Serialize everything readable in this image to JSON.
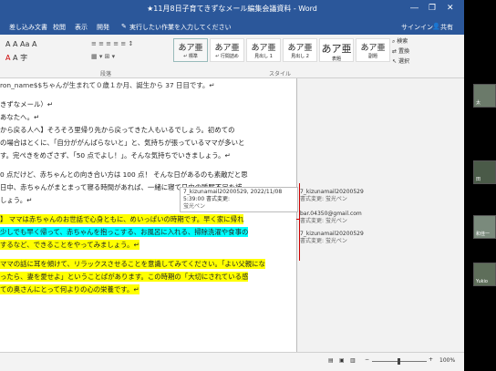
{
  "window": {
    "title": "★11月8日子育てきずなメール編集会議資料 - Word",
    "minimize": "―",
    "restore": "❐",
    "close": "✕"
  },
  "tabs": [
    "差し込み文書",
    "校閲",
    "表示",
    "開発"
  ],
  "tell_me": "実行したい作業を入力してください",
  "account": {
    "signin": "サインイン",
    "share": "共有"
  },
  "ribbon": {
    "styles": [
      {
        "sample": "あア亜",
        "label": "↵ 標準"
      },
      {
        "sample": "あア亜",
        "label": "↵ 行間詰め"
      },
      {
        "sample": "あア亜",
        "label": "見出し 1"
      },
      {
        "sample": "あア亜",
        "label": "見出し 2"
      },
      {
        "sample": "あア亜",
        "label": "表題"
      },
      {
        "sample": "あア亜",
        "label": "副題"
      }
    ],
    "groups": {
      "paragraph": "段落",
      "styles": "スタイル"
    },
    "editing": {
      "find": "検索",
      "replace": "置換",
      "select": "選択"
    },
    "font_tools": "A  A  Aa  A"
  },
  "document": {
    "lines": [
      {
        "text": "ron_name$$ちゃんが生まれて０歳１か月、誕生から 37 日目です。↵",
        "style": "none"
      },
      {
        "text": "きずなメール）↵",
        "style": "none"
      },
      {
        "text": "あなたへ。↵",
        "style": "none"
      },
      {
        "text": "から戻る人へ】そろそろ里帰り先から戻ってきた人もいるでしょう。初めての",
        "style": "none"
      },
      {
        "text": "の場合はとくに、「自分ががんばらないと」と、気持ちが張っているママが多いと",
        "style": "none"
      },
      {
        "text": "す。完ぺきをめざさず、「50 点でよし！」。そんな気持ちでいきましょう。↵",
        "style": "none"
      },
      {
        "text": "0 点だけど、赤ちゃんとの向き合い方は 100 点！ そんな日があるのも素敵だと思",
        "style": "none"
      },
      {
        "text": "日中、赤ちゃんがまとまって寝る時間があれば、一緒に寝て日中の睡眠不足を補",
        "style": "none"
      },
      {
        "text": "しょう。↵",
        "style": "none"
      },
      {
        "text": "】 ママは赤ちゃんのお世話で心身ともに、めいっぱいの時期です。早く家に帰れ",
        "style": "yellow"
      },
      {
        "text": "少しでも早く帰って、赤ちゃんを抱っこする、お風呂に入れる、掃除洗濯や食事の",
        "style": "cyan"
      },
      {
        "text": "するなど、できることをやってみましょう。↵",
        "style": "yellow"
      },
      {
        "text": "ママの話に耳を傾けて、リラックスさせることを意識してみてください。「よい父親にな",
        "style": "yellow"
      },
      {
        "text": "ったら、妻を愛せよ」ということばがあります。この時期の「大切にされている感",
        "style": "yellow"
      },
      {
        "text": "ての奥さんにとって何よりの心の栄養です。↵",
        "style": "yellow"
      }
    ]
  },
  "comments": [
    {
      "author": "7_kizunamail20200529, 2022/11/08",
      "meta": "5:39:00 書式変更:",
      "extra": "蛍光ペン"
    },
    {
      "author": "7_kizunamail20200529",
      "meta": "書式変更: 蛍光ペン",
      "extra": ""
    },
    {
      "author": "bar.04350@gmail.com",
      "meta": "書式変更: 蛍光ペン",
      "extra": ""
    },
    {
      "author": "7_kizunamail20200529",
      "meta": "書式変更: 蛍光ペン",
      "extra": ""
    }
  ],
  "statusbar": {
    "zoom": "100%",
    "minus": "−",
    "plus": "+"
  },
  "participants": [
    {
      "name": "太"
    },
    {
      "name": "田"
    },
    {
      "name": "和佳一"
    },
    {
      "name": "Yukio"
    }
  ],
  "colors": {
    "word_blue": "#2b579a",
    "highlight_yellow": "#ffff00",
    "highlight_cyan": "#00ffff"
  }
}
